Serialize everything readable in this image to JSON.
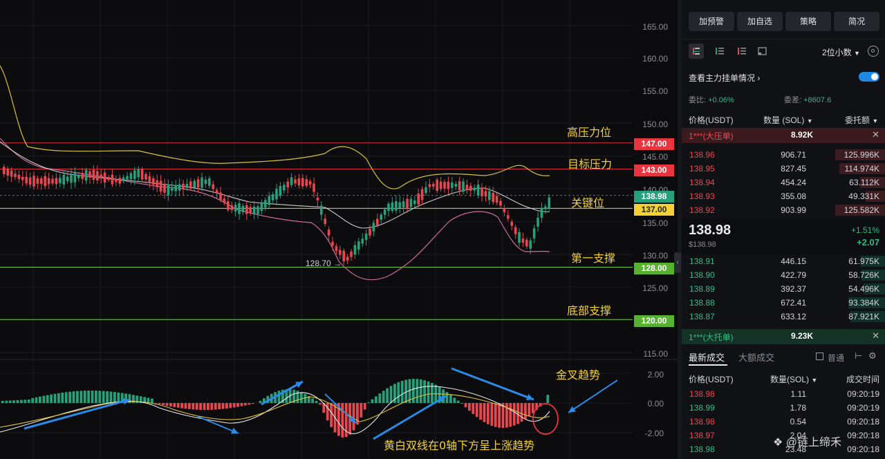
{
  "chart": {
    "y_axis_labels": [
      "165.00",
      "160.00",
      "155.00",
      "150.00",
      "145.00",
      "140.00",
      "135.00",
      "130.00",
      "125.00",
      "115.00"
    ],
    "macd_axis_labels": [
      "2.00",
      "0.00",
      "-2.00"
    ],
    "price_tags": {
      "p147": "147.00",
      "p143": "143.00",
      "current": "138.98",
      "p137": "137.00",
      "p128": "128.00",
      "p120": "120.00"
    },
    "low_marker": "128.70 →",
    "annotations": {
      "high_resistance": "高压力位",
      "target_resistance": "目标压力",
      "key_level": "关键位",
      "first_support": "第一支撑",
      "bottom_support": "底部支撑",
      "golden_cross": "金叉趋势",
      "macd_note": "黄白双线在0轴下方呈上涨趋势"
    },
    "watermark": "@链上缔禾",
    "colors": {
      "up": "#26a17b",
      "down": "#e8474f",
      "yellow": "#f4d234",
      "red_line": "#e8353f",
      "green_line": "#6ccf3a"
    }
  },
  "panel": {
    "top_buttons": [
      "加预警",
      "加自选",
      "策略",
      "简况"
    ],
    "decimal_select": "2位小数",
    "main_orders_link": "查看主力挂单情况",
    "wei_bi_label": "委比:",
    "wei_bi_value": "+0.06%",
    "wei_cha_label": "委差:",
    "wei_cha_value": "+8607.6",
    "headers": {
      "price": "价格(USDT)",
      "qty": "数量 (SOL)",
      "total": "委托额"
    },
    "big_ask_label": "1***(大压单)",
    "big_ask_value": "8.92K",
    "asks": [
      {
        "price": "138.96",
        "qty": "906.71",
        "total": "125.996K",
        "fill": 0.9
      },
      {
        "price": "138.95",
        "qty": "827.45",
        "total": "114.974K",
        "fill": 0.82
      },
      {
        "price": "138.94",
        "qty": "454.24",
        "total": "63.112K",
        "fill": 0.45
      },
      {
        "price": "138.93",
        "qty": "355.08",
        "total": "49.331K",
        "fill": 0.35
      },
      {
        "price": "138.92",
        "qty": "903.99",
        "total": "125.582K",
        "fill": 0.9
      }
    ],
    "last_price": "138.98",
    "last_price_usd": "$138.98",
    "change_pct": "+1.51%",
    "change_abs": "+2.07",
    "bids": [
      {
        "price": "138.91",
        "qty": "446.15",
        "total": "61.975K",
        "fill": 0.44
      },
      {
        "price": "138.90",
        "qty": "422.79",
        "total": "58.726K",
        "fill": 0.42
      },
      {
        "price": "138.89",
        "qty": "392.37",
        "total": "54.496K",
        "fill": 0.39
      },
      {
        "price": "138.88",
        "qty": "672.41",
        "total": "93.384K",
        "fill": 0.66
      },
      {
        "price": "138.87",
        "qty": "633.12",
        "total": "87.921K",
        "fill": 0.62
      }
    ],
    "big_bid_label": "1***(大托单)",
    "big_bid_value": "9.23K",
    "trades_tab_active": "最新成交",
    "trades_tab_other": "大额成交",
    "normal_label": "普通",
    "trade_headers": {
      "price": "价格(USDT)",
      "qty": "数量(SOL)",
      "time": "成交时间"
    },
    "trades": [
      {
        "price": "138.98",
        "qty": "1.11",
        "time": "09:20:19",
        "side": "down"
      },
      {
        "price": "138.99",
        "qty": "1.78",
        "time": "09:20:19",
        "side": "up"
      },
      {
        "price": "138.98",
        "qty": "0.54",
        "time": "09:20:18",
        "side": "down"
      },
      {
        "price": "138.97",
        "qty": "2.04",
        "time": "09:20:18",
        "side": "down"
      },
      {
        "price": "138.98",
        "qty": "23.48",
        "time": "09:20:18",
        "side": "up"
      }
    ]
  }
}
